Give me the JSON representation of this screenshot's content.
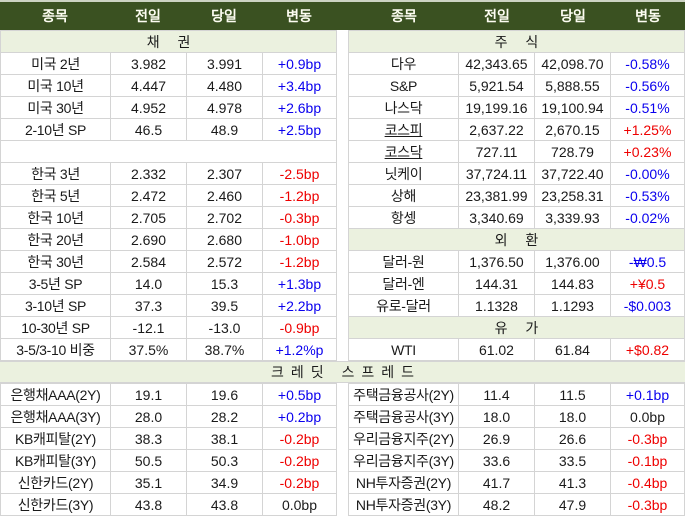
{
  "colors": {
    "header_bg": "#3a5121",
    "header_text": "#fdfdf2",
    "section_bg": "#ebf1df",
    "up_red": "#ee0000",
    "down_blue": "#0a00ee",
    "flat_black": "#1a1a1a",
    "border": "#d4d4d4"
  },
  "columns": [
    "종목",
    "전일",
    "당일",
    "변동"
  ],
  "bond_table": {
    "rows": [
      {
        "type": "section",
        "label": "채 권"
      },
      {
        "type": "data",
        "label": "미국 2년",
        "prev": "3.982",
        "cur": "3.991",
        "chg": "+0.9bp",
        "chg_color": "blue"
      },
      {
        "type": "data",
        "label": "미국 10년",
        "prev": "4.447",
        "cur": "4.480",
        "chg": "+3.4bp",
        "chg_color": "blue"
      },
      {
        "type": "data",
        "label": "미국 30년",
        "prev": "4.952",
        "cur": "4.978",
        "chg": "+2.6bp",
        "chg_color": "blue"
      },
      {
        "type": "data",
        "label": "2-10년 SP",
        "prev": "46.5",
        "cur": "48.9",
        "chg": "+2.5bp",
        "chg_color": "blue"
      },
      {
        "type": "spacer"
      },
      {
        "type": "data",
        "label": "한국 3년",
        "prev": "2.332",
        "cur": "2.307",
        "chg": "-2.5bp",
        "chg_color": "red"
      },
      {
        "type": "data",
        "label": "한국 5년",
        "prev": "2.472",
        "cur": "2.460",
        "chg": "-1.2bp",
        "chg_color": "red"
      },
      {
        "type": "data",
        "label": "한국 10년",
        "prev": "2.705",
        "cur": "2.702",
        "chg": "-0.3bp",
        "chg_color": "red"
      },
      {
        "type": "data",
        "label": "한국 20년",
        "prev": "2.690",
        "cur": "2.680",
        "chg": "-1.0bp",
        "chg_color": "red"
      },
      {
        "type": "data",
        "label": "한국 30년",
        "prev": "2.584",
        "cur": "2.572",
        "chg": "-1.2bp",
        "chg_color": "red"
      },
      {
        "type": "data",
        "label": "3-5년 SP",
        "prev": "14.0",
        "cur": "15.3",
        "chg": "+1.3bp",
        "chg_color": "blue"
      },
      {
        "type": "data",
        "label": "3-10년 SP",
        "prev": "37.3",
        "cur": "39.5",
        "chg": "+2.2bp",
        "chg_color": "blue"
      },
      {
        "type": "data",
        "label": "10-30년 SP",
        "prev": "-12.1",
        "cur": "-13.0",
        "chg": "-0.9bp",
        "chg_color": "red"
      },
      {
        "type": "data",
        "label": "3-5/3-10 비중",
        "prev": "37.5%",
        "cur": "38.7%",
        "chg": "+1.2%p",
        "chg_color": "blue"
      }
    ]
  },
  "market_table": {
    "rows": [
      {
        "type": "section",
        "label": "주 식"
      },
      {
        "type": "data",
        "label": "다우",
        "prev": "42,343.65",
        "cur": "42,098.70",
        "chg": "-0.58%",
        "chg_color": "blue"
      },
      {
        "type": "data",
        "label": "S&P",
        "prev": "5,921.54",
        "cur": "5,888.55",
        "chg": "-0.56%",
        "chg_color": "blue"
      },
      {
        "type": "data",
        "label": "나스닥",
        "prev": "19,199.16",
        "cur": "19,100.94",
        "chg": "-0.51%",
        "chg_color": "blue"
      },
      {
        "type": "data",
        "label": "코스피",
        "prev": "2,637.22",
        "cur": "2,670.15",
        "chg": "+1.25%",
        "chg_color": "red",
        "link": true
      },
      {
        "type": "data",
        "label": "코스닥",
        "prev": "727.11",
        "cur": "728.79",
        "chg": "+0.23%",
        "chg_color": "red",
        "link": true
      },
      {
        "type": "data",
        "label": "닛케이",
        "prev": "37,724.11",
        "cur": "37,722.40",
        "chg": "-0.00%",
        "chg_color": "blue"
      },
      {
        "type": "data",
        "label": "상해",
        "prev": "23,381.99",
        "cur": "23,258.31",
        "chg": "-0.53%",
        "chg_color": "blue"
      },
      {
        "type": "data",
        "label": "항셍",
        "prev": "3,340.69",
        "cur": "3,339.93",
        "chg": "-0.02%",
        "chg_color": "blue"
      },
      {
        "type": "section",
        "label": "외 환"
      },
      {
        "type": "data",
        "label": "달러-원",
        "prev": "1,376.50",
        "cur": "1,376.00",
        "chg": "-₩0.5",
        "chg_color": "blue"
      },
      {
        "type": "data",
        "label": "달러-엔",
        "prev": "144.31",
        "cur": "144.83",
        "chg": "+¥0.5",
        "chg_color": "red"
      },
      {
        "type": "data",
        "label": "유로-달러",
        "prev": "1.1328",
        "cur": "1.1293",
        "chg": "-$0.003",
        "chg_color": "blue"
      },
      {
        "type": "section",
        "label": "유 가"
      },
      {
        "type": "data",
        "label": "WTI",
        "prev": "61.02",
        "cur": "61.84",
        "chg": "+$0.82",
        "chg_color": "red"
      }
    ]
  },
  "credit": {
    "title": "크레딧 스프레드",
    "left": {
      "rows": [
        {
          "type": "data",
          "label": "은행채AAA(2Y)",
          "prev": "19.1",
          "cur": "19.6",
          "chg": "+0.5bp",
          "chg_color": "blue"
        },
        {
          "type": "data",
          "label": "은행채AAA(3Y)",
          "prev": "28.0",
          "cur": "28.2",
          "chg": "+0.2bp",
          "chg_color": "blue"
        },
        {
          "type": "data",
          "label": "KB캐피탈(2Y)",
          "prev": "38.3",
          "cur": "38.1",
          "chg": "-0.2bp",
          "chg_color": "red"
        },
        {
          "type": "data",
          "label": "KB캐피탈(3Y)",
          "prev": "50.5",
          "cur": "50.3",
          "chg": "-0.2bp",
          "chg_color": "red"
        },
        {
          "type": "data",
          "label": "신한카드(2Y)",
          "prev": "35.1",
          "cur": "34.9",
          "chg": "-0.2bp",
          "chg_color": "red"
        },
        {
          "type": "data",
          "label": "신한카드(3Y)",
          "prev": "43.8",
          "cur": "43.8",
          "chg": "0.0bp",
          "chg_color": "black"
        }
      ]
    },
    "right": {
      "rows": [
        {
          "type": "data",
          "label": "주택금융공사(2Y)",
          "prev": "11.4",
          "cur": "11.5",
          "chg": "+0.1bp",
          "chg_color": "blue"
        },
        {
          "type": "data",
          "label": "주택금융공사(3Y)",
          "prev": "18.0",
          "cur": "18.0",
          "chg": "0.0bp",
          "chg_color": "black"
        },
        {
          "type": "data",
          "label": "우리금융지주(2Y)",
          "prev": "26.9",
          "cur": "26.6",
          "chg": "-0.3bp",
          "chg_color": "red"
        },
        {
          "type": "data",
          "label": "우리금융지주(3Y)",
          "prev": "33.6",
          "cur": "33.5",
          "chg": "-0.1bp",
          "chg_color": "red"
        },
        {
          "type": "data",
          "label": "NH투자증권(2Y)",
          "prev": "41.7",
          "cur": "41.3",
          "chg": "-0.4bp",
          "chg_color": "red"
        },
        {
          "type": "data",
          "label": "NH투자증권(3Y)",
          "prev": "48.2",
          "cur": "47.9",
          "chg": "-0.3bp",
          "chg_color": "red"
        }
      ]
    }
  }
}
